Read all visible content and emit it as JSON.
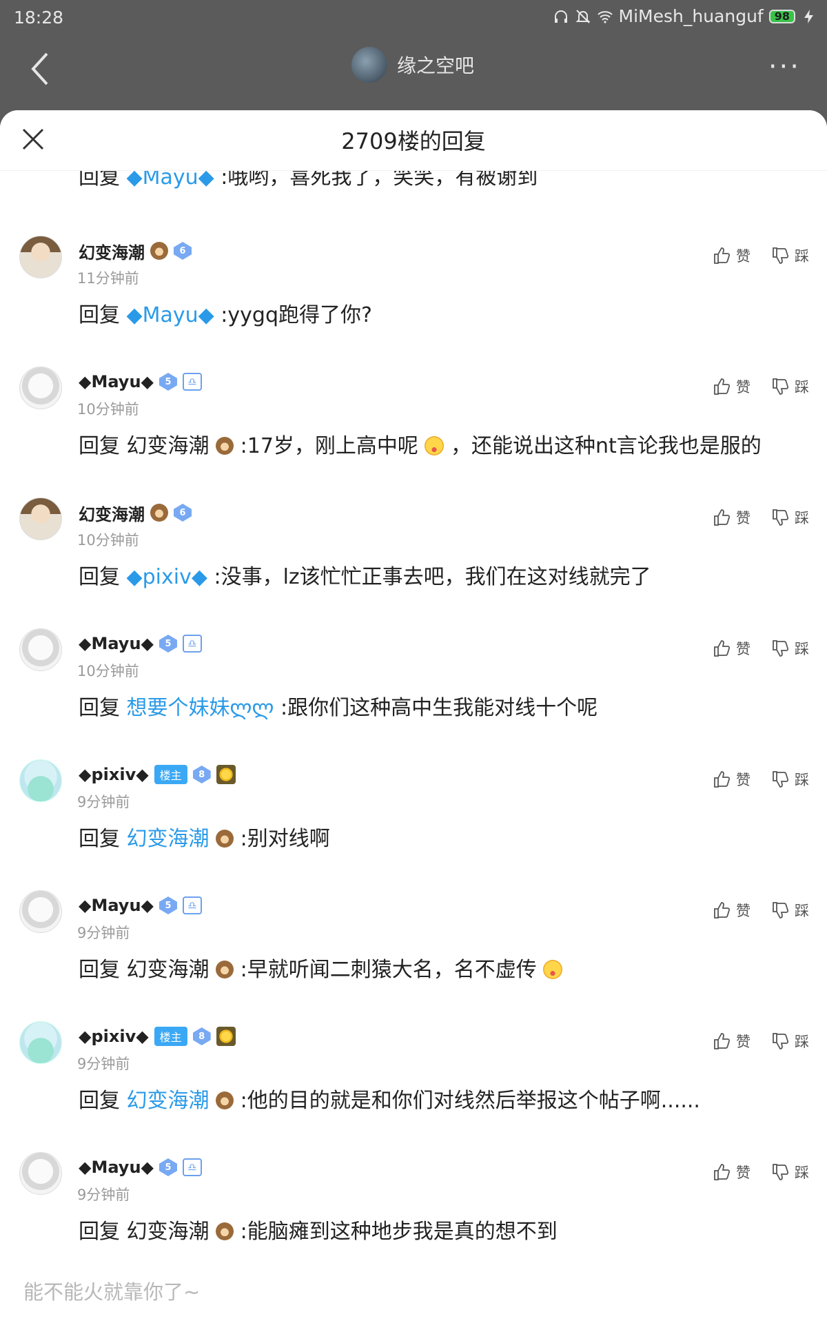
{
  "status_bar": {
    "time": "18:28",
    "network": "MiMesh_huanguf",
    "battery": "98"
  },
  "app_bar": {
    "forum_name": "缘之空吧"
  },
  "sheet": {
    "title": "2709楼的回复"
  },
  "partial_comment": {
    "prefix": "回复",
    "target": "◆Mayu◆",
    "text": ":哦哟，喜死我了，笑笑，有被谢到"
  },
  "actions": {
    "like": "赞",
    "dislike": "踩"
  },
  "comments": [
    {
      "user": "幻变海潮",
      "level": "6",
      "time": "11分钟前",
      "prefix": "回复",
      "target": "◆Mayu◆",
      "text": ":yygq跑得了你?"
    },
    {
      "user": "◆Mayu◆",
      "level": "5",
      "time": "10分钟前",
      "prefix": "回复",
      "target": "幻变海潮",
      "text": ":17岁，刚上高中呢",
      "text2": "，还能说出这种nt言论我也是服的"
    },
    {
      "user": "幻变海潮",
      "level": "6",
      "time": "10分钟前",
      "prefix": "回复",
      "target": "◆pixiv◆",
      "text": ":没事，lz该忙忙正事去吧，我们在这对线就完了"
    },
    {
      "user": "◆Mayu◆",
      "level": "5",
      "time": "10分钟前",
      "prefix": "回复",
      "target": "想要个妹妹ლლ",
      "text": ":跟你们这种高中生我能对线十个呢"
    },
    {
      "user": "◆pixiv◆",
      "badge": "楼主",
      "level": "8",
      "time": "9分钟前",
      "prefix": "回复",
      "target": "幻变海潮",
      "text": ":别对线啊"
    },
    {
      "user": "◆Mayu◆",
      "level": "5",
      "time": "9分钟前",
      "prefix": "回复",
      "target": "幻变海潮",
      "text": ":早就听闻二刺猿大名，名不虚传"
    },
    {
      "user": "◆pixiv◆",
      "badge": "楼主",
      "level": "8",
      "time": "9分钟前",
      "prefix": "回复",
      "target": "幻变海潮",
      "text": ":他的目的就是和你们对线然后举报这个帖子啊......"
    },
    {
      "user": "◆Mayu◆",
      "level": "5",
      "time": "9分钟前",
      "prefix": "回复",
      "target": "幻变海潮",
      "text": ":能脑瘫到这种地步我是真的想不到"
    }
  ],
  "input": {
    "placeholder": "能不能火就靠你了~"
  }
}
